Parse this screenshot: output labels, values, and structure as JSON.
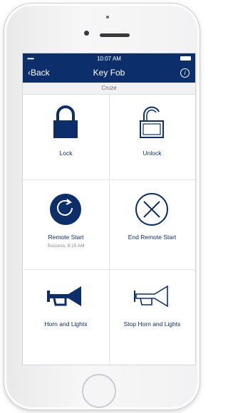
{
  "status": {
    "signal": "•••••",
    "time": "10:07 AM"
  },
  "nav": {
    "back_label": "‹Back",
    "title": "Key Fob",
    "info_icon": "i"
  },
  "subtitle": "Cruze",
  "actions": [
    {
      "label": "Lock",
      "icon": "lock-icon"
    },
    {
      "label": "Unlock",
      "icon": "unlock-icon"
    },
    {
      "label": "Remote Start",
      "status": "Success, 8:15 AM",
      "icon": "remote-start-icon"
    },
    {
      "label": "End Remote Start",
      "icon": "end-remote-start-icon"
    },
    {
      "label": "Horn and Lights",
      "icon": "horn-icon"
    },
    {
      "label": "Stop Horn and Lights",
      "icon": "stop-horn-icon"
    }
  ],
  "colors": {
    "brand": "#0c2f6b",
    "divider": "#e3e3e6"
  }
}
